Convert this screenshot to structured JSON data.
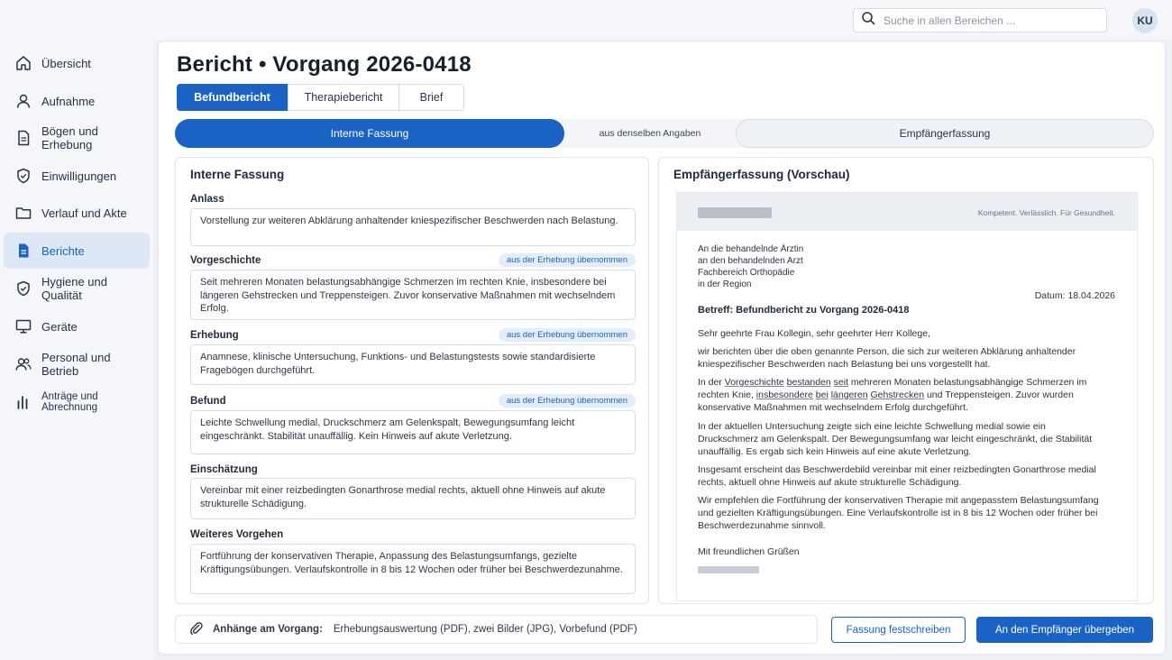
{
  "header": {
    "search_placeholder": "Suche in allen Bereichen ...",
    "avatar_initials": "KU"
  },
  "sidebar": {
    "items": [
      {
        "label": "Übersicht",
        "icon": "home-icon"
      },
      {
        "label": "Aufnahme",
        "icon": "user-icon"
      },
      {
        "label": "Bögen und Erhebung",
        "icon": "document-icon"
      },
      {
        "label": "Einwilligungen",
        "icon": "shield-icon"
      },
      {
        "label": "Verlauf und Akte",
        "icon": "folder-icon"
      },
      {
        "label": "Berichte",
        "icon": "report-icon",
        "active": true
      },
      {
        "label": "Hygiene und Qualität",
        "icon": "shield-check-icon"
      },
      {
        "label": "Geräte",
        "icon": "monitor-icon"
      },
      {
        "label": "Personal und Betrieb",
        "icon": "people-icon"
      },
      {
        "label": "Anträge und Abrechnung",
        "icon": "bar-chart-icon"
      }
    ]
  },
  "main": {
    "title": "Bericht • Vorgang 2026-0418",
    "tabs": [
      {
        "label": "Befundbericht",
        "active": true
      },
      {
        "label": "Therapiebericht"
      },
      {
        "label": "Brief"
      }
    ],
    "version_switch": {
      "left": "Interne Fassung",
      "middle": "aus denselben Angaben",
      "right": "Empfängerfassung"
    },
    "internal": {
      "title": "Interne Fassung",
      "badge": "aus der Erhebung übernommen",
      "fields": [
        {
          "label": "Anlass",
          "value": "Vorstellung zur weiteren Abklärung anhaltender kniespezifischer Beschwerden nach Belastung."
        },
        {
          "label": "Vorgeschichte",
          "value": "Seit mehreren Monaten belastungsabhängige Schmerzen im rechten Knie, insbesondere bei längeren Gehstrecken und Treppensteigen. Zuvor konservative Maßnahmen mit wechselndem Erfolg."
        },
        {
          "label": "Erhebung",
          "value": "Anamnese, klinische Untersuchung, Funktions- und Belastungstests sowie standardisierte Fragebögen durchgeführt."
        },
        {
          "label": "Befund",
          "value": "Leichte Schwellung medial, Druckschmerz am Gelenkspalt, Bewegungsumfang leicht eingeschränkt. Stabilität unauffällig. Kein Hinweis auf akute Verletzung."
        },
        {
          "label": "Einschätzung",
          "value": "Vereinbar mit einer reizbedingten Gonarthrose medial rechts, aktuell ohne Hinweis auf akute strukturelle Schädigung."
        },
        {
          "label": "Weiteres Vorgehen",
          "value": "Fortführung der konservativen Therapie, Anpassung des Belastungsumfangs, gezielte Kräftigungsübungen. Verlaufskontrolle in 8 bis 12 Wochen oder früher bei Beschwerdezunahme."
        }
      ]
    },
    "recipient": {
      "title": "Empfängerfassung (Vorschau)",
      "slogan": "Kompetent. Verlässlich. Für Gesundheit.",
      "address": [
        "An die behandelnde Ärztin",
        "an den behandelnden Arzt",
        "Fachbereich Orthopädie",
        "in der Region"
      ],
      "date": "Datum: 18.04.2026",
      "subject": "Betreff: Befundbericht zu Vorgang 2026-0418",
      "salutation": "Sehr geehrte Frau Kollegin, sehr geehrter Herr Kollege,",
      "p1": "wir berichten über die oben genannte Person, die sich zur weiteren Abklärung anhaltender kniespezifischer Beschwerden nach Belastung bei uns vorgestellt hat.",
      "p2_a": "In der ",
      "p2_u1": "Vorgeschichte",
      "p2_b": " ",
      "p2_u2": "bestanden",
      "p2_c": " ",
      "p2_u3": "seit",
      "p2_d": " mehreren Monaten belastungsabhängige Schmerzen im rechten Knie, ",
      "p2_u4": "insbesondere",
      "p2_e": " ",
      "p2_u5": "bei",
      "p2_f": " ",
      "p2_u6": "längeren",
      "p2_g": " ",
      "p2_u7": "Gehstrecken",
      "p2_h": " und Treppensteigen. Zuvor wurden konservative Maßnahmen mit wechselndem Erfolg durchgeführt.",
      "p3": "In der aktuellen Untersuchung zeigte sich eine leichte Schwellung medial sowie ein Druckschmerz am Gelenkspalt. Der Bewegungsumfang war leicht eingeschränkt, die Stabilität unauffällig. Es ergab sich kein Hinweis auf eine akute Verletzung.",
      "p4": "Insgesamt erscheint das Beschwerdebild vereinbar mit einer reizbedingten Gonarthrose medial rechts, aktuell ohne Hinweis auf akute strukturelle Schädigung.",
      "p5": "Wir empfehlen die Fortführung der konservativen Therapie mit angepasstem Belastungsumfang und gezielten Kräftigungsübungen. Eine Verlaufskontrolle ist in 8 bis 12 Wochen oder früher bei Beschwerdezunahme sinnvoll.",
      "closing": "Mit freundlichen Grüßen"
    },
    "attachments": {
      "label": "Anhänge am Vorgang:",
      "value": "Erhebungsauswertung (PDF), zwei Bilder (JPG), Vorbefund (PDF)"
    },
    "actions": {
      "lock": "Fassung festschreiben",
      "send": "An den Empfänger übergeben"
    }
  }
}
